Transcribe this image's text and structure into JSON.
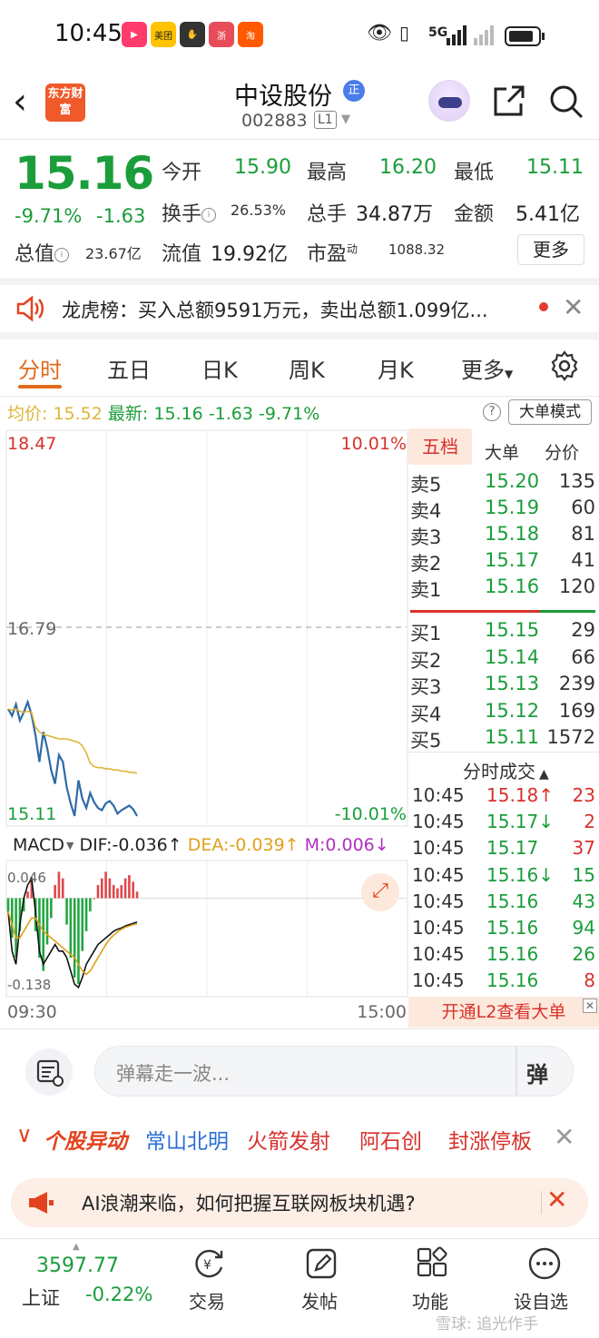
{
  "status_bar": {
    "time": "10:45",
    "app_icons": [
      {
        "name": "video-app",
        "text": "▶",
        "color": "#ff3b6b"
      },
      {
        "name": "meituan-app",
        "text": "美团",
        "color": "#ffc300"
      },
      {
        "name": "game-app",
        "text": "✋",
        "color": "#333333"
      },
      {
        "name": "weibo-app",
        "text": "浙",
        "color": "#e84b5a"
      },
      {
        "name": "taobao-app",
        "text": "淘",
        "color": "#ff5a00"
      }
    ],
    "network": "5G"
  },
  "header": {
    "logo_text": "东方财富",
    "stock_name": "中设股份",
    "badge": "正",
    "stock_code": "002883",
    "level": "L1"
  },
  "quote": {
    "price": "15.16",
    "change_pct": "-9.71%",
    "change": "-1.63",
    "open_label": "今开",
    "open": "15.90",
    "high_label": "最高",
    "high": "16.20",
    "low_label": "最低",
    "low": "15.11",
    "turnover_label": "换手",
    "turnover": "26.53%",
    "volume_label": "总手",
    "volume": "34.87万",
    "amount_label": "金额",
    "amount": "5.41亿",
    "mcap_label": "总值",
    "mcap": "23.67亿",
    "float_label": "流值",
    "float_cap": "19.92亿",
    "pe_label": "市盈",
    "pe_sup": "动",
    "pe": "1088.32",
    "more_label": "更多"
  },
  "dragon_tiger": {
    "text": "龙虎榜：买入总额9591万元，卖出总额1.099亿..."
  },
  "tabs": [
    "分时",
    "五日",
    "日K",
    "周K",
    "月K",
    "更多"
  ],
  "active_tab": 0,
  "info_line": {
    "avg_label": "均价:",
    "avg": "15.52",
    "latest_label": "最新:",
    "latest": "15.16",
    "change": "-1.63",
    "pct": "-9.71%",
    "big_order_label": "大单模式"
  },
  "chart_labels": {
    "top_price": "18.47",
    "top_pct": "10.01%",
    "mid_price": "16.79",
    "bottom_price": "15.11",
    "bottom_pct": "-10.01%",
    "macd_label": "MACD",
    "dif": "DIF:-0.036",
    "dea": "DEA:-0.039",
    "m": "M:0.006",
    "macd_top": "0.046",
    "macd_bottom": "-0.138",
    "time_start": "09:30",
    "time_end": "15:00"
  },
  "chart_data": {
    "type": "line",
    "ylim": [
      15.11,
      18.47
    ],
    "prev_close": 16.79,
    "series": [
      {
        "values": [
          16.08,
          16.02,
          16.12,
          15.98,
          16.05,
          16.14,
          16.03,
          15.85,
          15.62,
          15.88,
          15.74,
          15.55,
          15.43,
          15.68,
          15.62,
          15.4,
          15.26,
          15.15,
          15.46,
          15.3,
          15.22,
          15.35,
          15.27,
          15.22,
          15.2,
          15.26,
          15.28,
          15.24,
          15.17,
          15.2,
          15.22,
          15.24,
          15.21,
          15.15
        ]
      },
      {
        "values": [
          16.08,
          16.07,
          16.08,
          16.06,
          16.05,
          16.06,
          16.05,
          15.92,
          15.88,
          15.86,
          15.85,
          15.84,
          15.83,
          15.82,
          15.82,
          15.82,
          15.81,
          15.8,
          15.79,
          15.76,
          15.7,
          15.61,
          15.58,
          15.57,
          15.57,
          15.56,
          15.56,
          15.55,
          15.55,
          15.54,
          15.54,
          15.53,
          15.53,
          15.52
        ]
      }
    ]
  },
  "macd_data": {
    "ylim": [
      -0.138,
      0.046
    ],
    "hist": [
      -0.02,
      -0.06,
      -0.09,
      -0.05,
      -0.02,
      0.01,
      0.03,
      -0.05,
      -0.09,
      -0.11,
      -0.07,
      -0.03,
      0.02,
      0.04,
      0.03,
      -0.04,
      -0.09,
      -0.12,
      -0.13,
      -0.08,
      -0.05,
      -0.02,
      0.0,
      0.02,
      0.03,
      0.04,
      0.03,
      0.02,
      0.015,
      0.02,
      0.03,
      0.035,
      0.025,
      0.01
    ],
    "dif": [
      -0.02,
      -0.08,
      -0.1,
      -0.04,
      0.0,
      0.02,
      0.03,
      -0.02,
      -0.08,
      -0.1,
      -0.09,
      -0.08,
      -0.07,
      -0.08,
      -0.08,
      -0.09,
      -0.11,
      -0.13,
      -0.135,
      -0.12,
      -0.1,
      -0.09,
      -0.08,
      -0.07,
      -0.065,
      -0.06,
      -0.055,
      -0.05,
      -0.047,
      -0.045,
      -0.042,
      -0.04,
      -0.038,
      -0.036
    ],
    "dea": [
      -0.02,
      -0.04,
      -0.06,
      -0.06,
      -0.05,
      -0.04,
      -0.03,
      -0.03,
      -0.04,
      -0.05,
      -0.055,
      -0.06,
      -0.065,
      -0.07,
      -0.075,
      -0.08,
      -0.085,
      -0.09,
      -0.1,
      -0.11,
      -0.115,
      -0.11,
      -0.1,
      -0.09,
      -0.08,
      -0.07,
      -0.062,
      -0.056,
      -0.051,
      -0.047,
      -0.044,
      -0.042,
      -0.04,
      -0.039
    ]
  },
  "order_book": {
    "tabs": [
      "五档",
      "大单",
      "分价"
    ],
    "asks": [
      {
        "label": "卖5",
        "price": "15.20",
        "vol": "135"
      },
      {
        "label": "卖4",
        "price": "15.19",
        "vol": "60"
      },
      {
        "label": "卖3",
        "price": "15.18",
        "vol": "81"
      },
      {
        "label": "卖2",
        "price": "15.17",
        "vol": "41"
      },
      {
        "label": "卖1",
        "price": "15.16",
        "vol": "120"
      }
    ],
    "bids": [
      {
        "label": "买1",
        "price": "15.15",
        "vol": "29"
      },
      {
        "label": "买2",
        "price": "15.14",
        "vol": "66"
      },
      {
        "label": "买3",
        "price": "15.13",
        "vol": "239"
      },
      {
        "label": "买4",
        "price": "15.12",
        "vol": "169"
      },
      {
        "label": "买5",
        "price": "15.11",
        "vol": "1572"
      }
    ],
    "ticks_title": "分时成交",
    "ticks": [
      {
        "time": "10:45",
        "price": "15.18↑",
        "vol": "23",
        "color": "#d8312b",
        "vcolor": "#d8312b"
      },
      {
        "time": "10:45",
        "price": "15.17↓",
        "vol": "2",
        "color": "#1a9d3a",
        "vcolor": "#d8312b"
      },
      {
        "time": "10:45",
        "price": "15.17",
        "vol": "37",
        "color": "#1a9d3a",
        "vcolor": "#d8312b"
      },
      {
        "time": "10:45",
        "price": "15.16↓",
        "vol": "15",
        "color": "#1a9d3a",
        "vcolor": "#1a9d3a"
      },
      {
        "time": "10:45",
        "price": "15.16",
        "vol": "43",
        "color": "#1a9d3a",
        "vcolor": "#1a9d3a"
      },
      {
        "time": "10:45",
        "price": "15.16",
        "vol": "94",
        "color": "#1a9d3a",
        "vcolor": "#1a9d3a"
      },
      {
        "time": "10:45",
        "price": "15.16",
        "vol": "26",
        "color": "#1a9d3a",
        "vcolor": "#1a9d3a"
      },
      {
        "time": "10:45",
        "price": "15.16",
        "vol": "8",
        "color": "#1a9d3a",
        "vcolor": "#d8312b"
      }
    ],
    "l2_label": "开通L2查看大单"
  },
  "danmu": {
    "placeholder": "弹幕走一波...",
    "send_label": "弹"
  },
  "anomaly": {
    "title": "个股异动",
    "items": [
      {
        "text": "常山北明",
        "color": "#2a6fd1"
      },
      {
        "text": "火箭发射",
        "color": "#d8312b"
      },
      {
        "text": "阿石创",
        "color": "#d8312b"
      },
      {
        "text": "封涨停板",
        "color": "#d8312b"
      }
    ]
  },
  "ai_banner": {
    "text": "AI浪潮来临，如何把握互联网板块机遇?"
  },
  "bottom_nav": {
    "index_value": "3597.77",
    "index_name": "上证",
    "index_change": "-0.22%",
    "items": [
      "交易",
      "发帖",
      "功能",
      "设自选"
    ],
    "watermark": "雪球: 追光作手"
  },
  "colors": {
    "up": "#d8312b",
    "down": "#1a9d3a",
    "accent": "#e06b1a",
    "price_line": "#2f6aa8",
    "avg_line": "#e0b43a"
  }
}
